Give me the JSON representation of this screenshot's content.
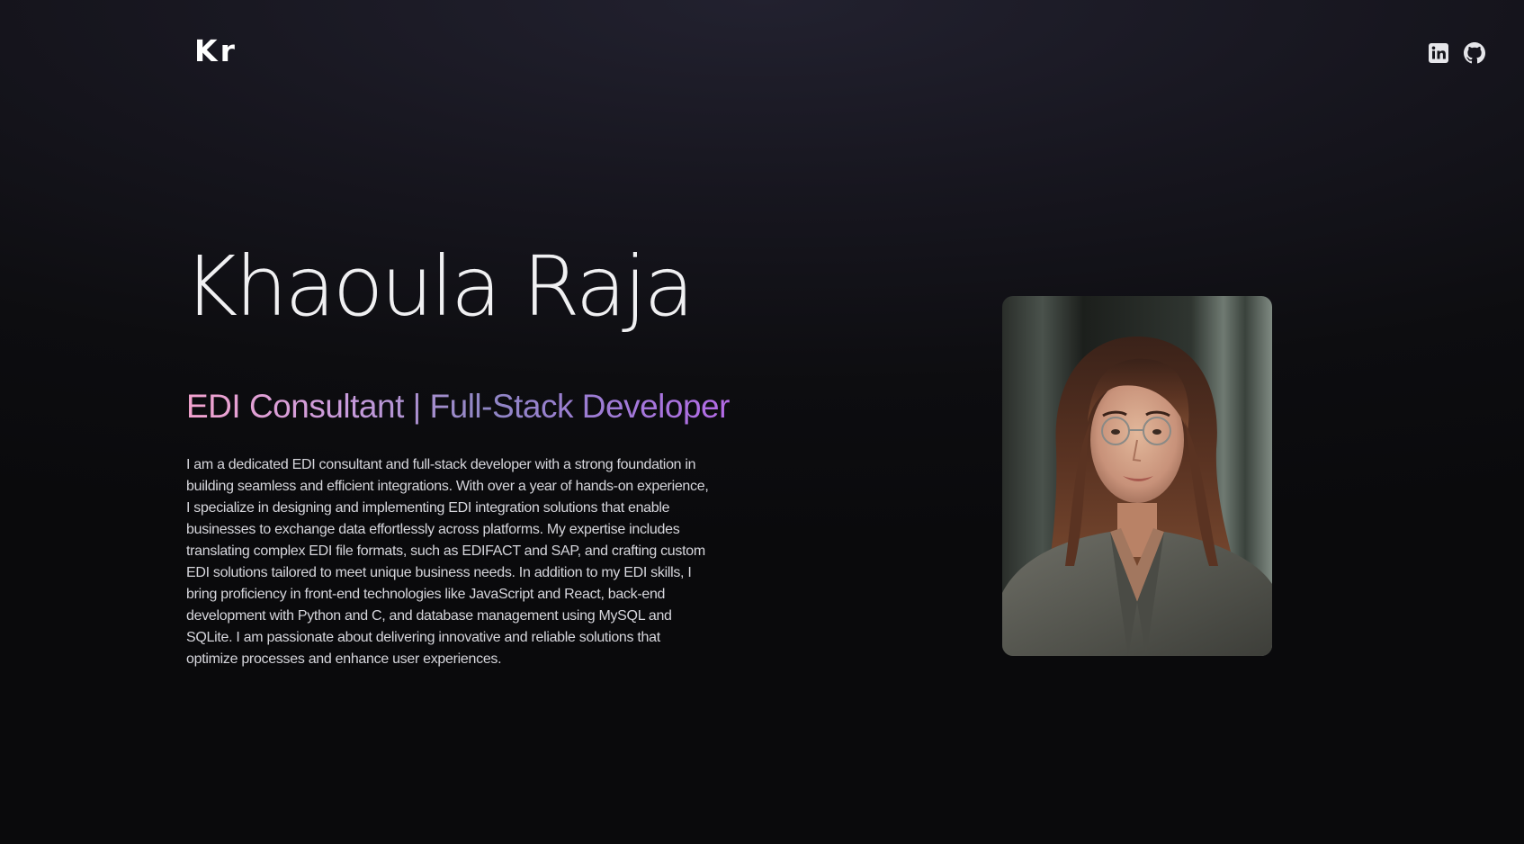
{
  "header": {
    "logo_text": "Kr",
    "social": [
      {
        "name": "linkedin-icon",
        "label": "LinkedIn"
      },
      {
        "name": "github-icon",
        "label": "GitHub"
      }
    ]
  },
  "hero": {
    "name": "Khaoula Raja",
    "role": "EDI Consultant | Full-Stack Developer",
    "bio": "I am a dedicated EDI consultant and full-stack developer with a strong foundation in building seamless and efficient integrations. With over a year of hands-on experience, I specialize in designing and implementing EDI integration solutions that enable businesses to exchange data effortlessly across platforms. My expertise includes translating complex EDI file formats, such as EDIFACT and SAP, and crafting custom EDI solutions tailored to meet unique business needs. In addition to my EDI skills, I bring proficiency in front-end technologies like JavaScript and React, back-end development with Python and C, and database management using MySQL and SQLite. I am passionate about delivering innovative and reliable solutions that optimize processes and enhance user experiences."
  },
  "colors": {
    "background": "#0a0a0c",
    "gradient_start": "#f4a3cf",
    "gradient_end": "#b46ae6"
  }
}
